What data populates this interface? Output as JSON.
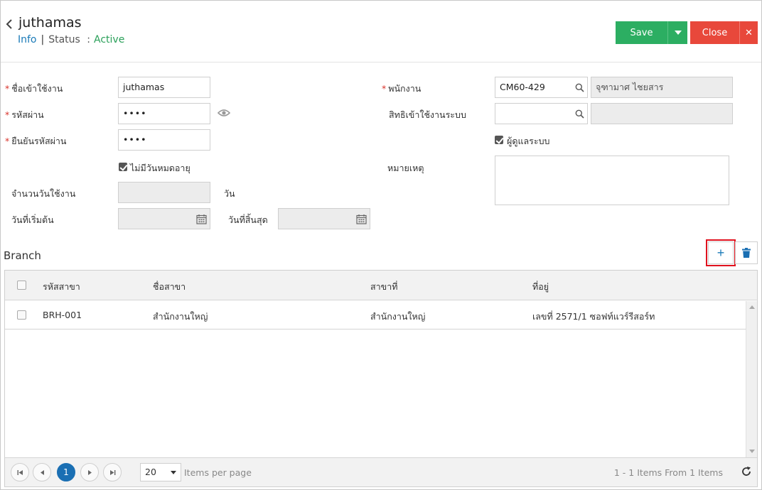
{
  "header": {
    "title": "juthamas",
    "info_label": "Info",
    "status_label": "Status",
    "status_colon": ":",
    "status_value": "Active",
    "save_label": "Save",
    "close_label": "Close",
    "close_x": "✕"
  },
  "form": {
    "username_label": "ชื่อเข้าใช้งาน",
    "username_value": "juthamas",
    "password_label": "รหัสผ่าน",
    "password_value": "••••",
    "confirm_label": "ยืนยันรหัสผ่าน",
    "confirm_value": "••••",
    "no_expiry_label": "ไม่มีวันหมดอายุ",
    "no_expiry_checked": true,
    "days_label": "จำนวนวันใช้งาน",
    "days_value": "",
    "days_unit": "วัน",
    "start_label": "วันที่เริ่มต้น",
    "start_value": "",
    "end_label": "วันที่สิ้นสุด",
    "end_value": "",
    "employee_label": "พนักงาน",
    "employee_code": "CM60-429",
    "employee_name": "จุฑามาศ ไชยสาร",
    "access_label": "สิทธิเข้าใช้งานระบบ",
    "access_value": "",
    "access_name": "",
    "admin_label": "ผู้ดูแลระบบ",
    "admin_checked": true,
    "note_label": "หมายเหตุ",
    "note_value": ""
  },
  "branch": {
    "title": "Branch",
    "add_label": "+",
    "columns": [
      "รหัสสาขา",
      "ชื่อสาขา",
      "สาขาที่",
      "ที่อยู่"
    ],
    "rows": [
      [
        "BRH-001",
        "สำนักงานใหญ่",
        "สำนักงานใหญ่",
        "เลขที่ 2571/1 ซอฟท์แวร์รีสอร์ท"
      ]
    ],
    "pager": {
      "current_page": "1",
      "page_size": "20",
      "items_per_page_label": "Items per page",
      "summary": "1 - 1 Items From 1 Items"
    }
  }
}
